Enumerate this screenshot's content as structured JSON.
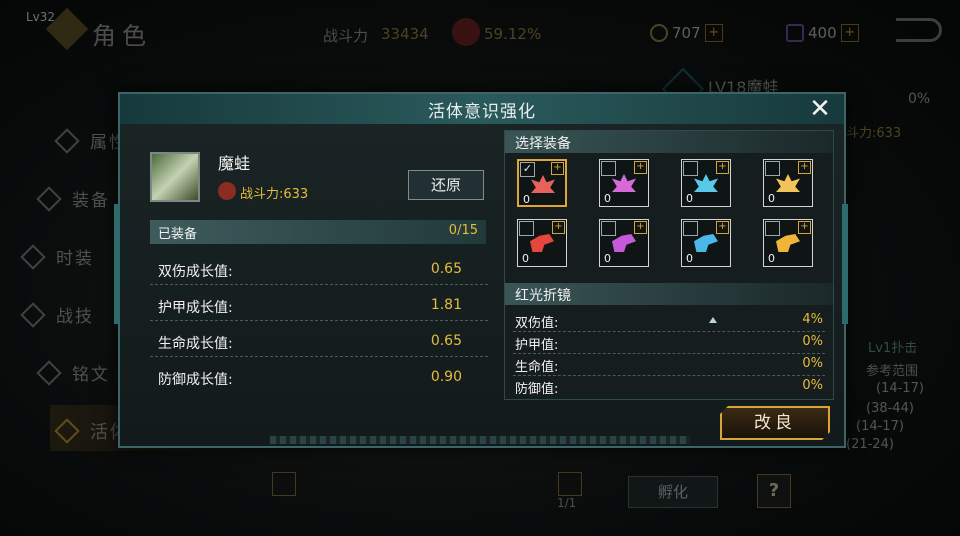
{
  "top": {
    "level": "Lv32",
    "title": "角色",
    "power_label": "战斗力",
    "power_value": "33434",
    "percent": "59.12%",
    "currency1": "707",
    "currency2": "400",
    "plus": "+"
  },
  "menu": {
    "items": [
      {
        "label": "属性",
        "icon": "attribute-icon"
      },
      {
        "label": "装备",
        "icon": "equipment-icon"
      },
      {
        "label": "时装",
        "icon": "fashion-icon"
      },
      {
        "label": "战技",
        "icon": "skill-icon"
      },
      {
        "label": "铭文",
        "icon": "inscription-icon"
      },
      {
        "label": "活体意识",
        "icon": "living-consciousness-icon"
      }
    ]
  },
  "background": {
    "level_name": "LV18魔蛙",
    "progress_percent": "0%",
    "power": "斗力:633",
    "lv1_attack": "Lv1扑击",
    "ref_range": "参考范围",
    "ranges": [
      "(14-17)",
      "(38-44)",
      "(14-17)",
      "(21-24)"
    ],
    "page": "1/1",
    "hatch": "孵化",
    "help": "?"
  },
  "dialog": {
    "title": "活体意识强化",
    "close": "✕",
    "item_name": "魔蛙",
    "item_power": "战斗力:633",
    "restore": "还原",
    "equipped_label": "已装备",
    "equipped_count": "0/15",
    "stats": [
      {
        "label": "双伤成长值:",
        "value": "0.65"
      },
      {
        "label": "护甲成长值:",
        "value": "1.81"
      },
      {
        "label": "生命成长值:",
        "value": "0.65"
      },
      {
        "label": "防御成长值:",
        "value": "0.90"
      }
    ],
    "select_title": "选择装备",
    "slots": [
      {
        "count": "0",
        "color": "#e8615a",
        "selected": true
      },
      {
        "count": "0",
        "color": "#d86ad8",
        "selected": false
      },
      {
        "count": "0",
        "color": "#5ac8ea",
        "selected": false
      },
      {
        "count": "0",
        "color": "#f0c45a",
        "selected": false
      },
      {
        "count": "0",
        "color": "#e5473f",
        "selected": false
      },
      {
        "count": "0",
        "color": "#c45ad8",
        "selected": false
      },
      {
        "count": "0",
        "color": "#4ab8e8",
        "selected": false
      },
      {
        "count": "0",
        "color": "#f0b43a",
        "selected": false
      }
    ],
    "lens_title": "红光折镜",
    "bonuses": [
      {
        "label": "双伤值:",
        "value": "4%"
      },
      {
        "label": "护甲值:",
        "value": "0%"
      },
      {
        "label": "生命值:",
        "value": "0%"
      },
      {
        "label": "防御值:",
        "value": "0%"
      }
    ],
    "improve": "改良"
  }
}
